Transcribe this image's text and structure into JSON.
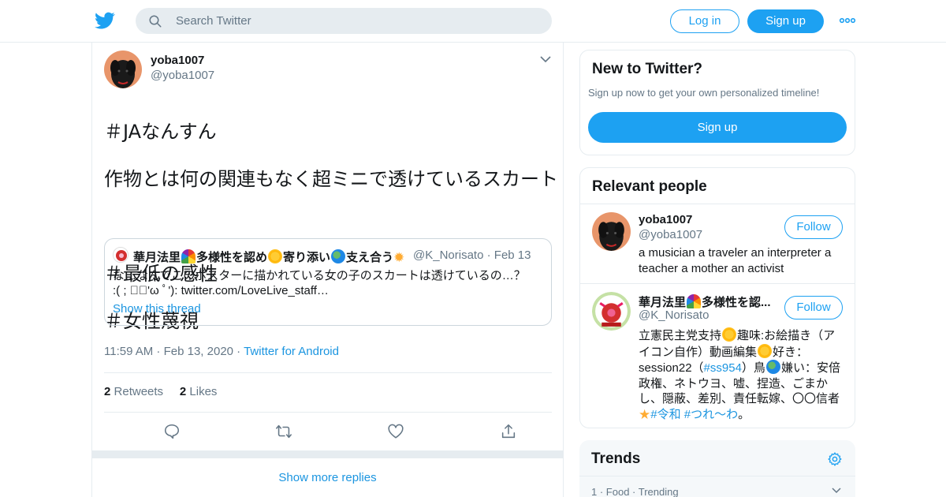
{
  "header": {
    "search_placeholder": "Search Twitter",
    "login_label": "Log in",
    "signup_label": "Sign up",
    "more_label": "•••",
    "brand_color": "#1da1f2"
  },
  "tweet": {
    "name": "yoba1007",
    "handle": "@yoba1007",
    "lines": [
      "＃JAなんすん",
      "作物とは何の関連もなく超ミニで透けているスカート",
      "",
      "＃最低の感性",
      "＃女性蔑視"
    ],
    "quote": {
      "name_parts": [
        "華月法里",
        "多様性を認め",
        "寄り添い",
        "支え合う"
      ],
      "handle": "@K_Norisato",
      "date": "Feb 13",
      "text_line1": "な…なんでこのポスターに描かれている女の子のスカートは透けているの…？",
      "text_line2": ":( ; ﾟﾟ'ω ﾟ'): twitter.com/LoveLive_staff…",
      "show_thread": "Show this thread"
    },
    "time": "11:59 AM",
    "date": "Feb 13, 2020",
    "source": "Twitter for Android",
    "retweets_count": "2",
    "retweets_label": "Retweets",
    "likes_count": "2",
    "likes_label": "Likes",
    "show_more_replies": "Show more replies"
  },
  "sidebar": {
    "new": {
      "title": "New to Twitter?",
      "subtitle": "Sign up now to get your own personalized timeline!",
      "button": "Sign up"
    },
    "relevant": {
      "title": "Relevant people",
      "people": [
        {
          "name": "yoba1007",
          "handle": "@yoba1007",
          "follow": "Follow",
          "bio": "a musician a traveler an interpreter a teacher a mother an activist"
        },
        {
          "name_parts": [
            "華月法里",
            "多様性を認..."
          ],
          "handle": "@K_Norisato",
          "follow": "Follow",
          "bio_parts": {
            "a": "立憲民主党支持",
            "b": "趣味:お絵描き（アイコン自作）動画編集",
            "c": "好き：session22（",
            "hashtag1": "#ss954",
            "d": "）鳥",
            "e": "嫌い：安倍政権、ネトウヨ、嘘、捏造、ごまかし、隠蔽、差別、責任転嫁、〇〇信者",
            "hashtag2": "#令和",
            "hashtag3": "#つれ〜わ",
            "f": "。"
          }
        }
      ]
    },
    "trends": {
      "title": "Trends",
      "first_rank": "1",
      "first_category": "Food",
      "first_status": "Trending"
    }
  }
}
